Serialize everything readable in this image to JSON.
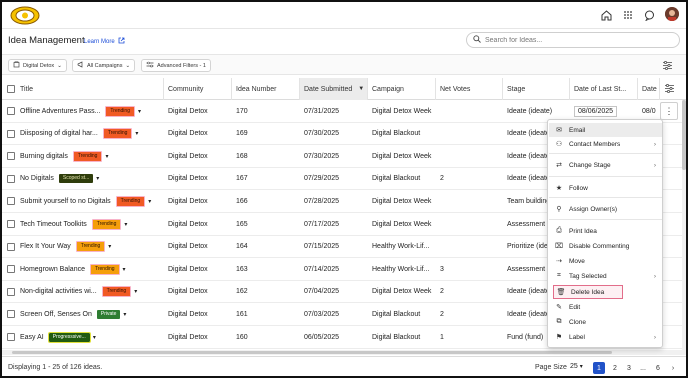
{
  "nav": {
    "icons": [
      "home-icon",
      "apps-grid-icon",
      "chat-icon",
      "user-avatar"
    ]
  },
  "page": {
    "title": "Idea Management",
    "learn_more": "Learn More",
    "search_placeholder": "Search for Ideas..."
  },
  "filters": {
    "community": "Digital Detox",
    "campaigns": "All Campaigns",
    "advanced": "Advanced Filters - 1"
  },
  "columns": [
    "Title",
    "Community",
    "Idea Number",
    "Date Submitted",
    "Campaign",
    "Net Votes",
    "Stage",
    "Date of Last St...",
    "Date"
  ],
  "rows": [
    {
      "title": "Offline Adventures Pass...",
      "badge": "Trending",
      "badge_type": "trending",
      "community": "Digital Detox",
      "number": "170",
      "date": "07/31/2025",
      "campaign": "Digital Detox Week",
      "votes": "",
      "stage": "Ideate (ideate)",
      "last": "08/06/2025",
      "last_boxed": true,
      "date2": "08/0"
    },
    {
      "title": "Diisposing of digital har...",
      "badge": "Trending",
      "badge_type": "trending",
      "community": "Digital Detox",
      "number": "169",
      "date": "07/30/2025",
      "campaign": "Digital Blackout",
      "votes": "",
      "stage": "Ideate (ideate)",
      "last": "",
      "last_boxed": false,
      "date2": ""
    },
    {
      "title": "Burning digitals",
      "badge": "Trending",
      "badge_type": "trending",
      "community": "Digital Detox",
      "number": "168",
      "date": "07/30/2025",
      "campaign": "Digital Detox Week",
      "votes": "",
      "stage": "Ideate (ideate)",
      "last": "",
      "last_boxed": false,
      "date2": ""
    },
    {
      "title": "No Digitals",
      "badge": "Scoped st...",
      "badge_type": "scoped",
      "community": "Digital Detox",
      "number": "167",
      "date": "07/29/2025",
      "campaign": "Digital Blackout",
      "votes": "2",
      "stage": "Ideate (ideate)",
      "last": "",
      "last_boxed": false,
      "date2": ""
    },
    {
      "title": "Submit yourself to no Digitals",
      "badge": "Trending",
      "badge_type": "trending-pink",
      "community": "Digital Detox",
      "number": "166",
      "date": "07/28/2025",
      "campaign": "Digital Detox Week",
      "votes": "",
      "stage": "Team building",
      "last": "",
      "last_boxed": false,
      "date2": ""
    },
    {
      "title": "Tech Timeout Toolkits",
      "badge": "Trending",
      "badge_type": "trending-orange",
      "community": "Digital Detox",
      "number": "165",
      "date": "07/17/2025",
      "campaign": "Digital Detox Week",
      "votes": "",
      "stage": "Assessment (",
      "last": "",
      "last_boxed": false,
      "date2": ""
    },
    {
      "title": "Flex It Your Way",
      "badge": "Trending",
      "badge_type": "trending-orange",
      "community": "Digital Detox",
      "number": "164",
      "date": "07/15/2025",
      "campaign": "Healthy Work-Lif...",
      "votes": "",
      "stage": "Prioritize (ide",
      "last": "",
      "last_boxed": false,
      "date2": ""
    },
    {
      "title": "Homegrown Balance",
      "badge": "Trending",
      "badge_type": "trending-orange",
      "community": "Digital Detox",
      "number": "163",
      "date": "07/14/2025",
      "campaign": "Healthy Work-Lif...",
      "votes": "3",
      "stage": "Assessment (",
      "last": "",
      "last_boxed": false,
      "date2": ""
    },
    {
      "title": "Non-digital activities wi...",
      "badge": "Trending",
      "badge_type": "trending-pink",
      "community": "Digital Detox",
      "number": "162",
      "date": "07/04/2025",
      "campaign": "Digital Detox Week",
      "votes": "2",
      "stage": "Ideate (ideate)",
      "last": "",
      "last_boxed": false,
      "date2": ""
    },
    {
      "title": "Screen Off, Senses On",
      "badge": "Private",
      "badge_type": "private",
      "community": "Digital Detox",
      "number": "161",
      "date": "07/03/2025",
      "campaign": "Digital Blackout",
      "votes": "2",
      "stage": "Ideate (ideate)",
      "last": "",
      "last_boxed": false,
      "date2": ""
    },
    {
      "title": "Easy AI",
      "badge": "Progresssive...",
      "badge_type": "progress",
      "community": "Digital Detox",
      "number": "160",
      "date": "06/05/2025",
      "campaign": "Digital Blackout",
      "votes": "1",
      "stage": "Fund (fund)",
      "last": "",
      "last_boxed": false,
      "date2": ""
    }
  ],
  "menu": {
    "items": [
      {
        "label": "Email",
        "icon": "mail-icon",
        "chevron": false
      },
      {
        "label": "Contact Members",
        "icon": "people-icon",
        "chevron": true
      },
      {
        "label": "Change Stage",
        "icon": "stage-icon",
        "chevron": true
      },
      {
        "label": "Follow",
        "icon": "star-icon",
        "chevron": false
      },
      {
        "label": "Assign Owner(s)",
        "icon": "assign-icon",
        "chevron": false
      },
      {
        "label": "Print Idea",
        "icon": "print-icon",
        "chevron": false
      },
      {
        "label": "Disable Commenting",
        "icon": "comment-off-icon",
        "chevron": false
      },
      {
        "label": "Move",
        "icon": "move-icon",
        "chevron": false
      },
      {
        "label": "Tag Selected",
        "icon": "tag-icon",
        "chevron": true
      },
      {
        "label": "Delete Idea",
        "icon": "trash-icon",
        "chevron": false
      },
      {
        "label": "Edit",
        "icon": "edit-icon",
        "chevron": false
      },
      {
        "label": "Clone",
        "icon": "clone-icon",
        "chevron": false
      },
      {
        "label": "Label",
        "icon": "label-icon",
        "chevron": true
      }
    ]
  },
  "footer": {
    "summary": "Displaying 1 - 25 of 126 ideas.",
    "page_size_label": "Page Size",
    "page_size": "25",
    "pages": [
      "1",
      "2",
      "3",
      "...",
      "6"
    ],
    "active_page": "1"
  },
  "colors": {
    "accent": "#2152c8",
    "trending": "#f15a24",
    "private": "#2e7d32",
    "delete_border": "#e26d8a"
  }
}
